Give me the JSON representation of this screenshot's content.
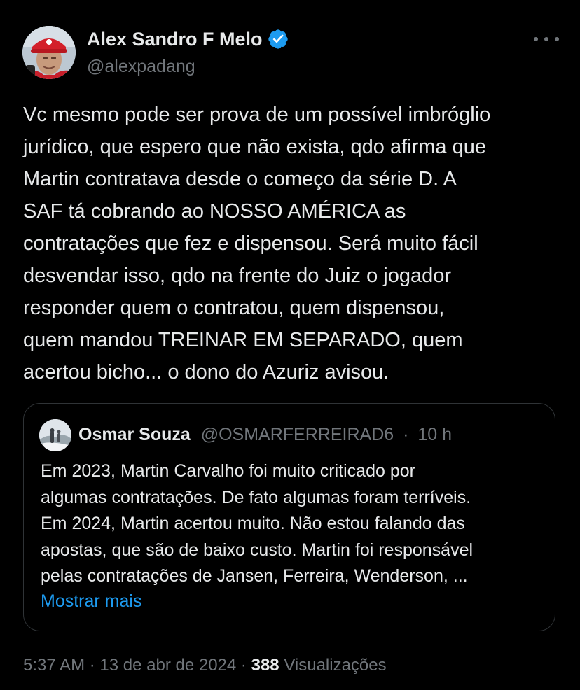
{
  "author": {
    "name": "Alex Sandro F Melo",
    "handle": "@alexpadang",
    "verified_color": "#1d9bf0"
  },
  "tweet": {
    "text": "Vc mesmo pode ser prova de um possível imbróglio\njurídico, que espero que não exista, qdo afirma que\nMartin contratava desde o começo da série D. A\nSAF tá cobrando ao NOSSO AMÉRICA as\ncontratações que fez e dispensou. Será muito fácil\ndesvendar isso, qdo na frente do Juiz o jogador\nresponder quem o contratou, quem dispensou,\nquem mandou TREINAR EM SEPARADO, quem\nacertou bicho... o dono do Azuriz avisou."
  },
  "quote": {
    "name": "Osmar Souza",
    "handle": "@OSMARFERREIRAD6",
    "separator": "·",
    "time": "10 h",
    "text": "Em 2023, Martin Carvalho foi muito criticado por\nalgumas contratações. De fato algumas foram terríveis.\nEm 2024, Martin acertou muito. Não estou falando das\napostas, que são de baixo custo. Martin foi responsável\npelas contratações de Jansen, Ferreira, Wenderson, ...",
    "show_more": "Mostrar mais"
  },
  "footer": {
    "time": "5:37 AM",
    "sep1": "·",
    "date": "13 de abr de 2024",
    "sep2": "·",
    "views_count": "388",
    "views_label": "Visualizações"
  },
  "colors": {
    "background": "#000000",
    "text": "#e7e9ea",
    "secondary": "#71767b",
    "link": "#1d9bf0",
    "border": "#2f3336"
  },
  "icons": {
    "verified": "verified-badge-icon",
    "more": "more-horizontal-icon"
  }
}
